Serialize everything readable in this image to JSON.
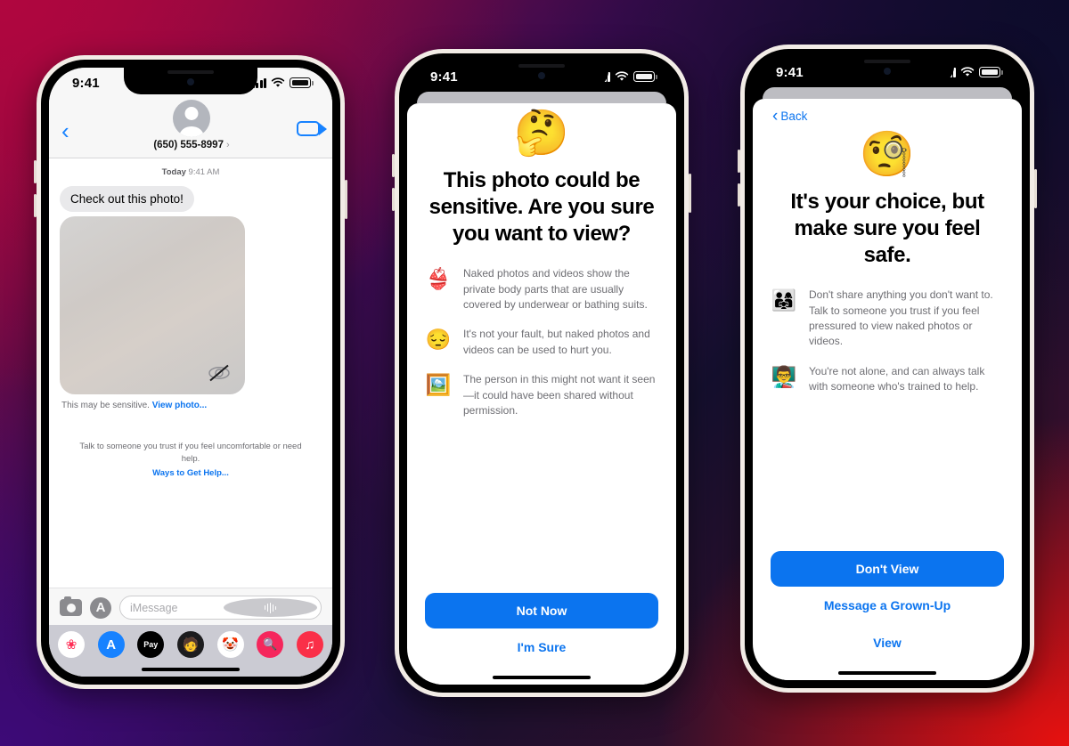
{
  "background": {
    "colors": [
      "#b0063f",
      "#0d0b2b",
      "#3d0a78",
      "#e8110f"
    ]
  },
  "accent": {
    "blue": "#0b74ef",
    "ios_blue": "#1782ff",
    "gray_text": "#6e6e73"
  },
  "phone1": {
    "status": {
      "time": "9:41",
      "signal_icon": "cellular-bars-icon",
      "wifi_icon": "wifi-icon",
      "battery_icon": "battery-icon"
    },
    "header": {
      "back_icon": "back-chevron-icon",
      "avatar_icon": "contact-avatar-icon",
      "contact_name": "(650) 555-8997",
      "disclosure": "›",
      "facetime_icon": "facetime-video-icon"
    },
    "thread": {
      "timestamp_prefix": "Today",
      "timestamp_time": "9:41 AM",
      "message": "Check out this photo!",
      "photo_overlay_icon": "eye-slash-icon",
      "sensitive_note": "This may be sensitive.",
      "view_photo_link": "View photo...",
      "help_text": "Talk to someone you trust if you feel uncomfortable or need help.",
      "help_link": "Ways to Get Help..."
    },
    "composer": {
      "camera_icon": "camera-icon",
      "apps_icon": "app-store-icon",
      "placeholder": "iMessage",
      "audio_icon": "audio-waveform-icon"
    },
    "app_drawer": [
      {
        "name": "photos-app-icon",
        "glyph": "❀",
        "bg": "#ffffff",
        "color": "#ff2d55"
      },
      {
        "name": "app-store-app-icon",
        "glyph": "A",
        "bg": "#1782ff",
        "color": "#ffffff"
      },
      {
        "name": "apple-pay-app-icon",
        "glyph": "Pay",
        "bg": "#000000",
        "color": "#ffffff"
      },
      {
        "name": "memoji-app-icon",
        "glyph": "🧑",
        "bg": "#1c1c1e",
        "color": "#ffffff"
      },
      {
        "name": "stickers-app-icon",
        "glyph": "🤡",
        "bg": "#ffffff",
        "color": "#000000"
      },
      {
        "name": "image-search-app-icon",
        "glyph": "🔍",
        "bg": "#f5275c",
        "color": "#ffffff"
      },
      {
        "name": "music-app-icon",
        "glyph": "♫",
        "bg": "#fa2f48",
        "color": "#ffffff"
      }
    ]
  },
  "phone2": {
    "status": {
      "time": "9:41"
    },
    "sheet": {
      "hero_emoji": "🤔",
      "title": "This photo could be sensitive. Are you sure you want to view?",
      "bullets": [
        {
          "emoji": "👙",
          "icon": "swimsuit-icon",
          "text": "Naked photos and videos show the private body parts that are usually covered by underwear or bathing suits."
        },
        {
          "emoji": "😔",
          "icon": "pensive-face-icon",
          "text": "It's not your fault, but naked photos and videos can be used to hurt you."
        },
        {
          "emoji": "🖼️",
          "icon": "framed-picture-icon",
          "text": "The person in this might not want it seen—it could have been shared without permission."
        }
      ],
      "primary_button": "Not Now",
      "secondary_button": "I'm Sure"
    }
  },
  "phone3": {
    "status": {
      "time": "9:41"
    },
    "sheet": {
      "back_label": "Back",
      "hero_emoji": "🧐",
      "title": "It's your choice, but make sure you feel safe.",
      "bullets": [
        {
          "emoji": "👨‍👩‍👧",
          "icon": "family-icon",
          "text": "Don't share anything you don't want to. Talk to someone you trust if you feel pressured to view naked photos or videos."
        },
        {
          "emoji": "👨‍🏫",
          "icon": "teacher-icon",
          "text": "You're not alone, and can always talk with someone who's trained to help."
        }
      ],
      "primary_button": "Don't View",
      "secondary_button": "Message a Grown-Up",
      "tertiary_button": "View"
    }
  }
}
